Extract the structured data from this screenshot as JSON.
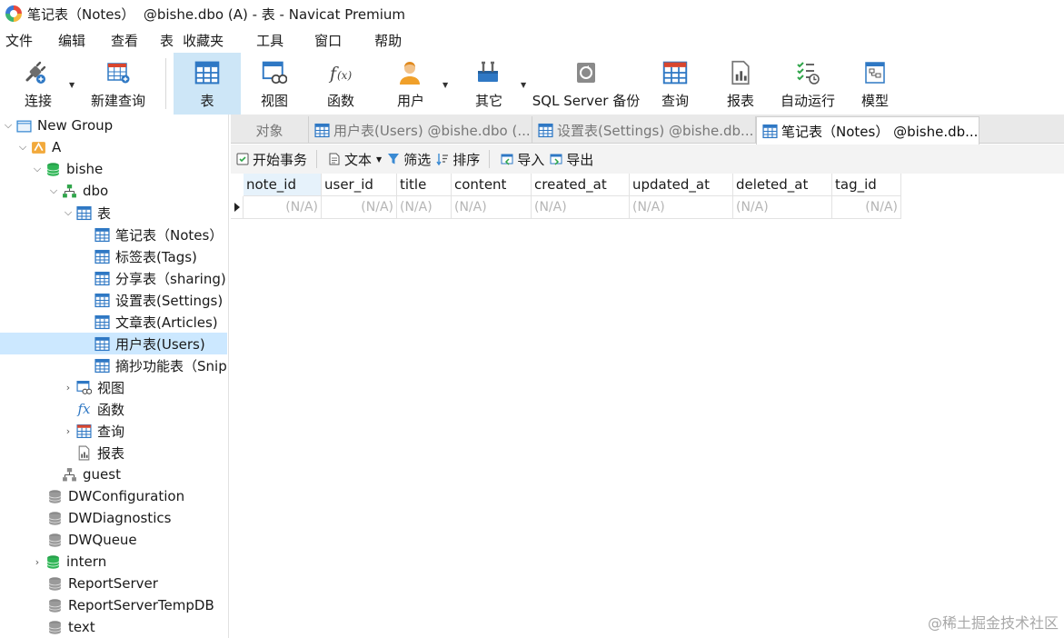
{
  "window": {
    "title": "笔记表（Notes）  @bishe.dbo (A) - 表 - Navicat Premium"
  },
  "menu": [
    "文件",
    "编辑",
    "查看",
    "表",
    "收藏夹",
    "工具",
    "窗口",
    "帮助"
  ],
  "toolbar": {
    "connect": "连接",
    "new_query": "新建查询",
    "table": "表",
    "view": "视图",
    "function": "函数",
    "user": "用户",
    "other": "其它",
    "backup": "SQL Server 备份",
    "query": "查询",
    "report": "报表",
    "automation": "自动运行",
    "model": "模型"
  },
  "tree": {
    "new_group": "New Group",
    "conn_a": "A",
    "db_bishe": "bishe",
    "schema_dbo": "dbo",
    "tables_node": "表",
    "tables": [
      "笔记表（Notes）",
      "标签表(Tags)",
      "分享表（sharing)",
      "设置表(Settings)",
      "文章表(Articles)",
      "用户表(Users)",
      "摘抄功能表（Snip"
    ],
    "views_node": "视图",
    "functions_node": "函数",
    "queries_node": "查询",
    "reports_node": "报表",
    "schema_guest": "guest",
    "databases": [
      "DWConfiguration",
      "DWDiagnostics",
      "DWQueue",
      "intern",
      "ReportServer",
      "ReportServerTempDB",
      "text"
    ]
  },
  "tabs": {
    "objects": "对象",
    "users": "用户表(Users) @bishe.dbo (...",
    "settings": "设置表(Settings) @bishe.db...",
    "notes": "笔记表（Notes）  @bishe.db..."
  },
  "subtoolbar": {
    "begin_tx": "开始事务",
    "text": "文本",
    "filter": "筛选",
    "sort": "排序",
    "import": "导入",
    "export": "导出"
  },
  "grid": {
    "columns": [
      "note_id",
      "user_id",
      "title",
      "content",
      "created_at",
      "updated_at",
      "deleted_at",
      "tag_id"
    ],
    "row": [
      "(N/A)",
      "(N/A)",
      "(N/A)",
      "(N/A)",
      "(N/A)",
      "(N/A)",
      "(N/A)",
      "(N/A)"
    ]
  },
  "watermark": "@稀土掘金技术社区"
}
